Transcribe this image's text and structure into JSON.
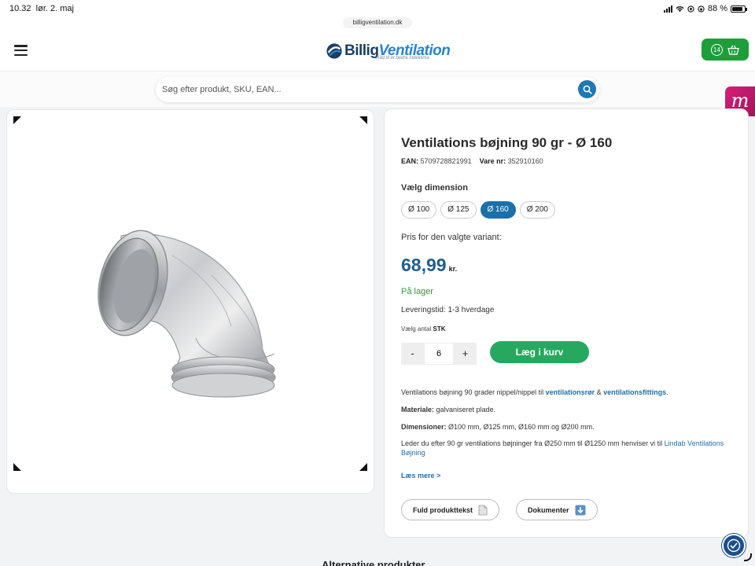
{
  "status_bar": {
    "time": "10.32",
    "date": "lør. 2. maj",
    "battery": "88 %",
    "battery_level": 0.88
  },
  "browser": {
    "url": "billigventilation.dk"
  },
  "header": {
    "logo_text_bold": "Billig",
    "logo_text_light": "Ventilation",
    "logo_tagline": "Råd til et bedre indeklima",
    "cart_count": "14"
  },
  "search": {
    "placeholder": "Søg efter produkt, SKU, EAN..."
  },
  "side_badge": "m",
  "product": {
    "title": "Ventilations bøjning 90 gr - Ø 160",
    "ean_label": "EAN:",
    "ean": "5709728821991",
    "sku_label": "Vare nr:",
    "sku": "352910160",
    "dimension_label": "Vælg dimension",
    "dimensions": [
      {
        "label": "Ø 100",
        "selected": false
      },
      {
        "label": "Ø 125",
        "selected": false
      },
      {
        "label": "Ø 160",
        "selected": true
      },
      {
        "label": "Ø 200",
        "selected": false
      }
    ],
    "price_label": "Pris for den valgte variant:",
    "price": "68,99",
    "currency": "kr.",
    "stock": "På lager",
    "delivery": "Leveringstid: 1-3 hverdage",
    "qty_label": "Vælg antal",
    "qty_unit": "STK",
    "qty_minus": "-",
    "qty_plus": "+",
    "qty_value": "6",
    "add_to_cart": "Læg i kurv",
    "desc1_text": "Ventilations bøjning 90 grader nippel/nippel til ",
    "desc1_link1": "ventilationsrør",
    "desc1_mid": " & ",
    "desc1_link2": "ventilationsfittings",
    "desc1_end": ".",
    "material_label": "Materiale:",
    "material": " galvaniseret plade.",
    "dimensions_label": "Dimensioner:",
    "dimensions_text": " Ø100 mm, Ø125 mm, Ø160 mm og Ø200 mm.",
    "desc4_text": "Leder du efter 90 gr ventilations bøjninger fra Ø250 mm til Ø1250 mm henviser vi til ",
    "desc4_link": "Lindab Ventilations Bøjning",
    "read_more": "Læs mere >",
    "full_text_button": "Fuld produkttekst",
    "documents_button": "Dokumenter"
  },
  "section_title": "Alternative produkter",
  "colors": {
    "accent_blue": "#1a70aa",
    "green": "#27a860",
    "cart_green": "#1e9e3b",
    "price_blue": "#1f5f8e"
  }
}
